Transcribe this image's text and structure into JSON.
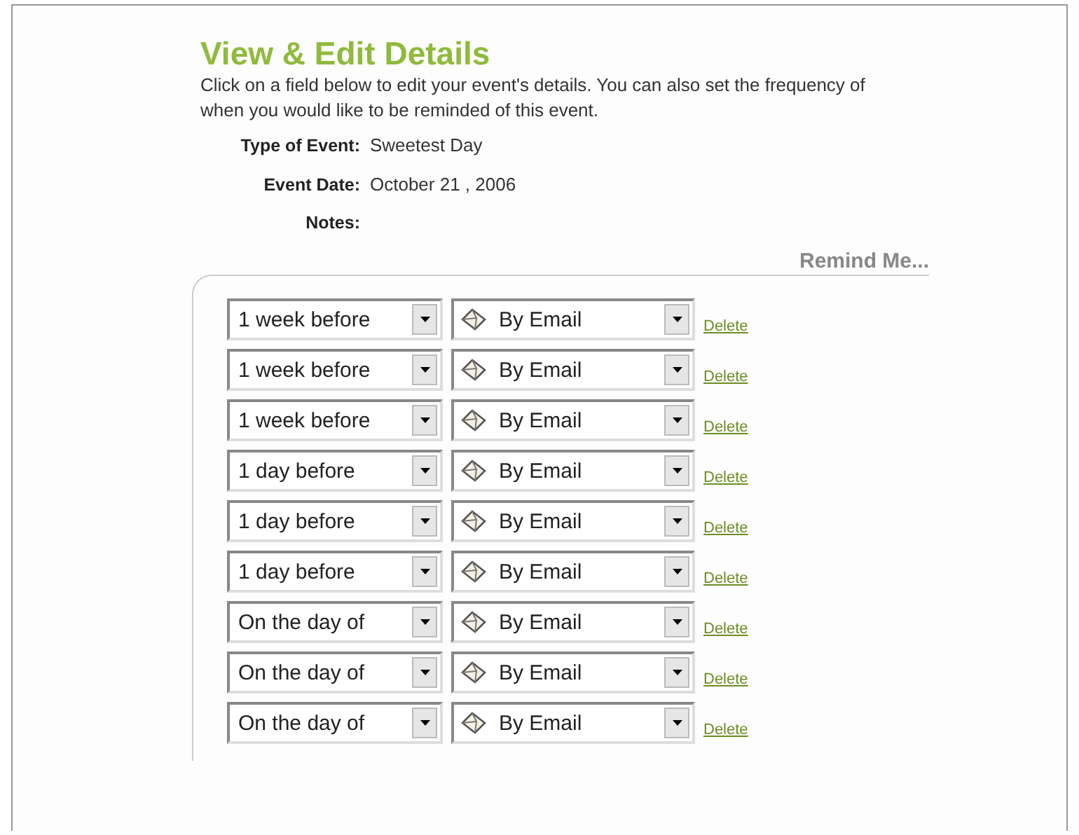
{
  "heading": "View & Edit Details",
  "intro": "Click on a field below to edit your event's details. You can also set the frequency of when you would like to be reminded of this event.",
  "details": [
    {
      "label": "Type of Event:",
      "value": "Sweetest Day"
    },
    {
      "label": "Event Date:",
      "value": "October 21 , 2006"
    },
    {
      "label": "Notes:"
    }
  ],
  "remind_title": "Remind Me...",
  "reminders": [
    {
      "when": "1 week before",
      "method": "By Email",
      "action": "Delete"
    },
    {
      "when": "1 week before",
      "method": "By Email",
      "action": "Delete"
    },
    {
      "when": "1 week before",
      "method": "By Email",
      "action": "Delete"
    },
    {
      "when": "1 day before",
      "method": "By Email",
      "action": "Delete"
    },
    {
      "when": "1 day before",
      "method": "By Email",
      "action": "Delete"
    },
    {
      "when": "1 day before",
      "method": "By Email",
      "action": "Delete"
    },
    {
      "when": "On the day of",
      "method": "By Email",
      "action": "Delete"
    },
    {
      "when": "On the day of",
      "method": "By Email",
      "action": "Delete"
    },
    {
      "when": "On the day of",
      "method": "By Email",
      "action": "Delete"
    }
  ]
}
